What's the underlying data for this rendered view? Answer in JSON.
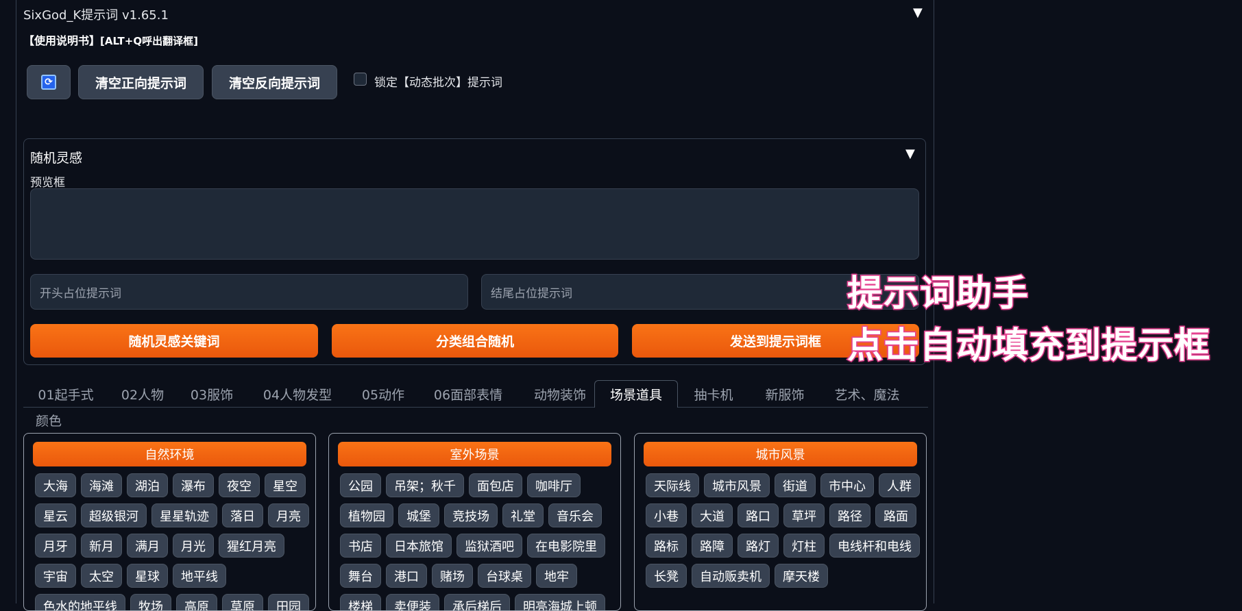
{
  "app": {
    "title": "SixGod_K提示词 v1.65.1"
  },
  "manual": {
    "bold": "【使用说明书】",
    "hint": "[ALT+Q呼出翻译框]"
  },
  "toolbar": {
    "refresh_icon_glyph": "⟳",
    "clear_positive": "清空正向提示词",
    "clear_negative": "清空反向提示词",
    "lock_label": "锁定【动态批次】提示词"
  },
  "random_panel": {
    "title": "随机灵感",
    "preview_label": "预览框",
    "prefix_placeholder": "开头占位提示词",
    "suffix_placeholder": "结尾占位提示词",
    "btn_random": "随机灵感关键词",
    "btn_category": "分类组合随机",
    "btn_send": "发送到提示词框"
  },
  "overlay": {
    "line1": "提示词助手",
    "line2": "点击自动填充到提示框"
  },
  "tabs": [
    "01起手式",
    "02人物",
    "03服饰",
    "04人物发型",
    "05动作",
    "06面部表情",
    "动物装饰",
    "场景道具",
    "抽卡机",
    "新服饰",
    "艺术、魔法",
    "颜色"
  ],
  "active_tab": "场景道具",
  "cards": [
    {
      "title": "自然环境",
      "rows": [
        [
          "大海",
          "海滩",
          "湖泊",
          "瀑布",
          "夜空",
          "星空"
        ],
        [
          "星云",
          "超级银河",
          "星星轨迹",
          "落日",
          "月亮"
        ],
        [
          "月牙",
          "新月",
          "满月",
          "月光",
          "猩红月亮"
        ],
        [
          "宇宙",
          "太空",
          "星球",
          "地平线"
        ],
        [
          "色水的地平线",
          "牧场",
          "高原",
          "草原",
          "田园"
        ]
      ]
    },
    {
      "title": "室外场景",
      "rows": [
        [
          "公园",
          "吊架；秋千",
          "面包店",
          "咖啡厅"
        ],
        [
          "植物园",
          "城堡",
          "竞技场",
          "礼堂",
          "音乐会"
        ],
        [
          "书店",
          "日本旅馆",
          "监狱酒吧",
          "在电影院里"
        ],
        [
          "舞台",
          "港口",
          "赌场",
          "台球桌",
          "地牢"
        ],
        [
          "楼梯",
          "卖便装",
          "承后梯后",
          "明亮海城上顿"
        ]
      ]
    },
    {
      "title": "城市风景",
      "rows": [
        [
          "天际线",
          "城市风景",
          "街道",
          "市中心",
          "人群"
        ],
        [
          "小巷",
          "大道",
          "路口",
          "草坪",
          "路径",
          "路面"
        ],
        [
          "路标",
          "路障",
          "路灯",
          "灯柱",
          "电线杆和电线"
        ],
        [
          "长凳",
          "自动贩卖机",
          "摩天楼"
        ]
      ]
    }
  ]
}
